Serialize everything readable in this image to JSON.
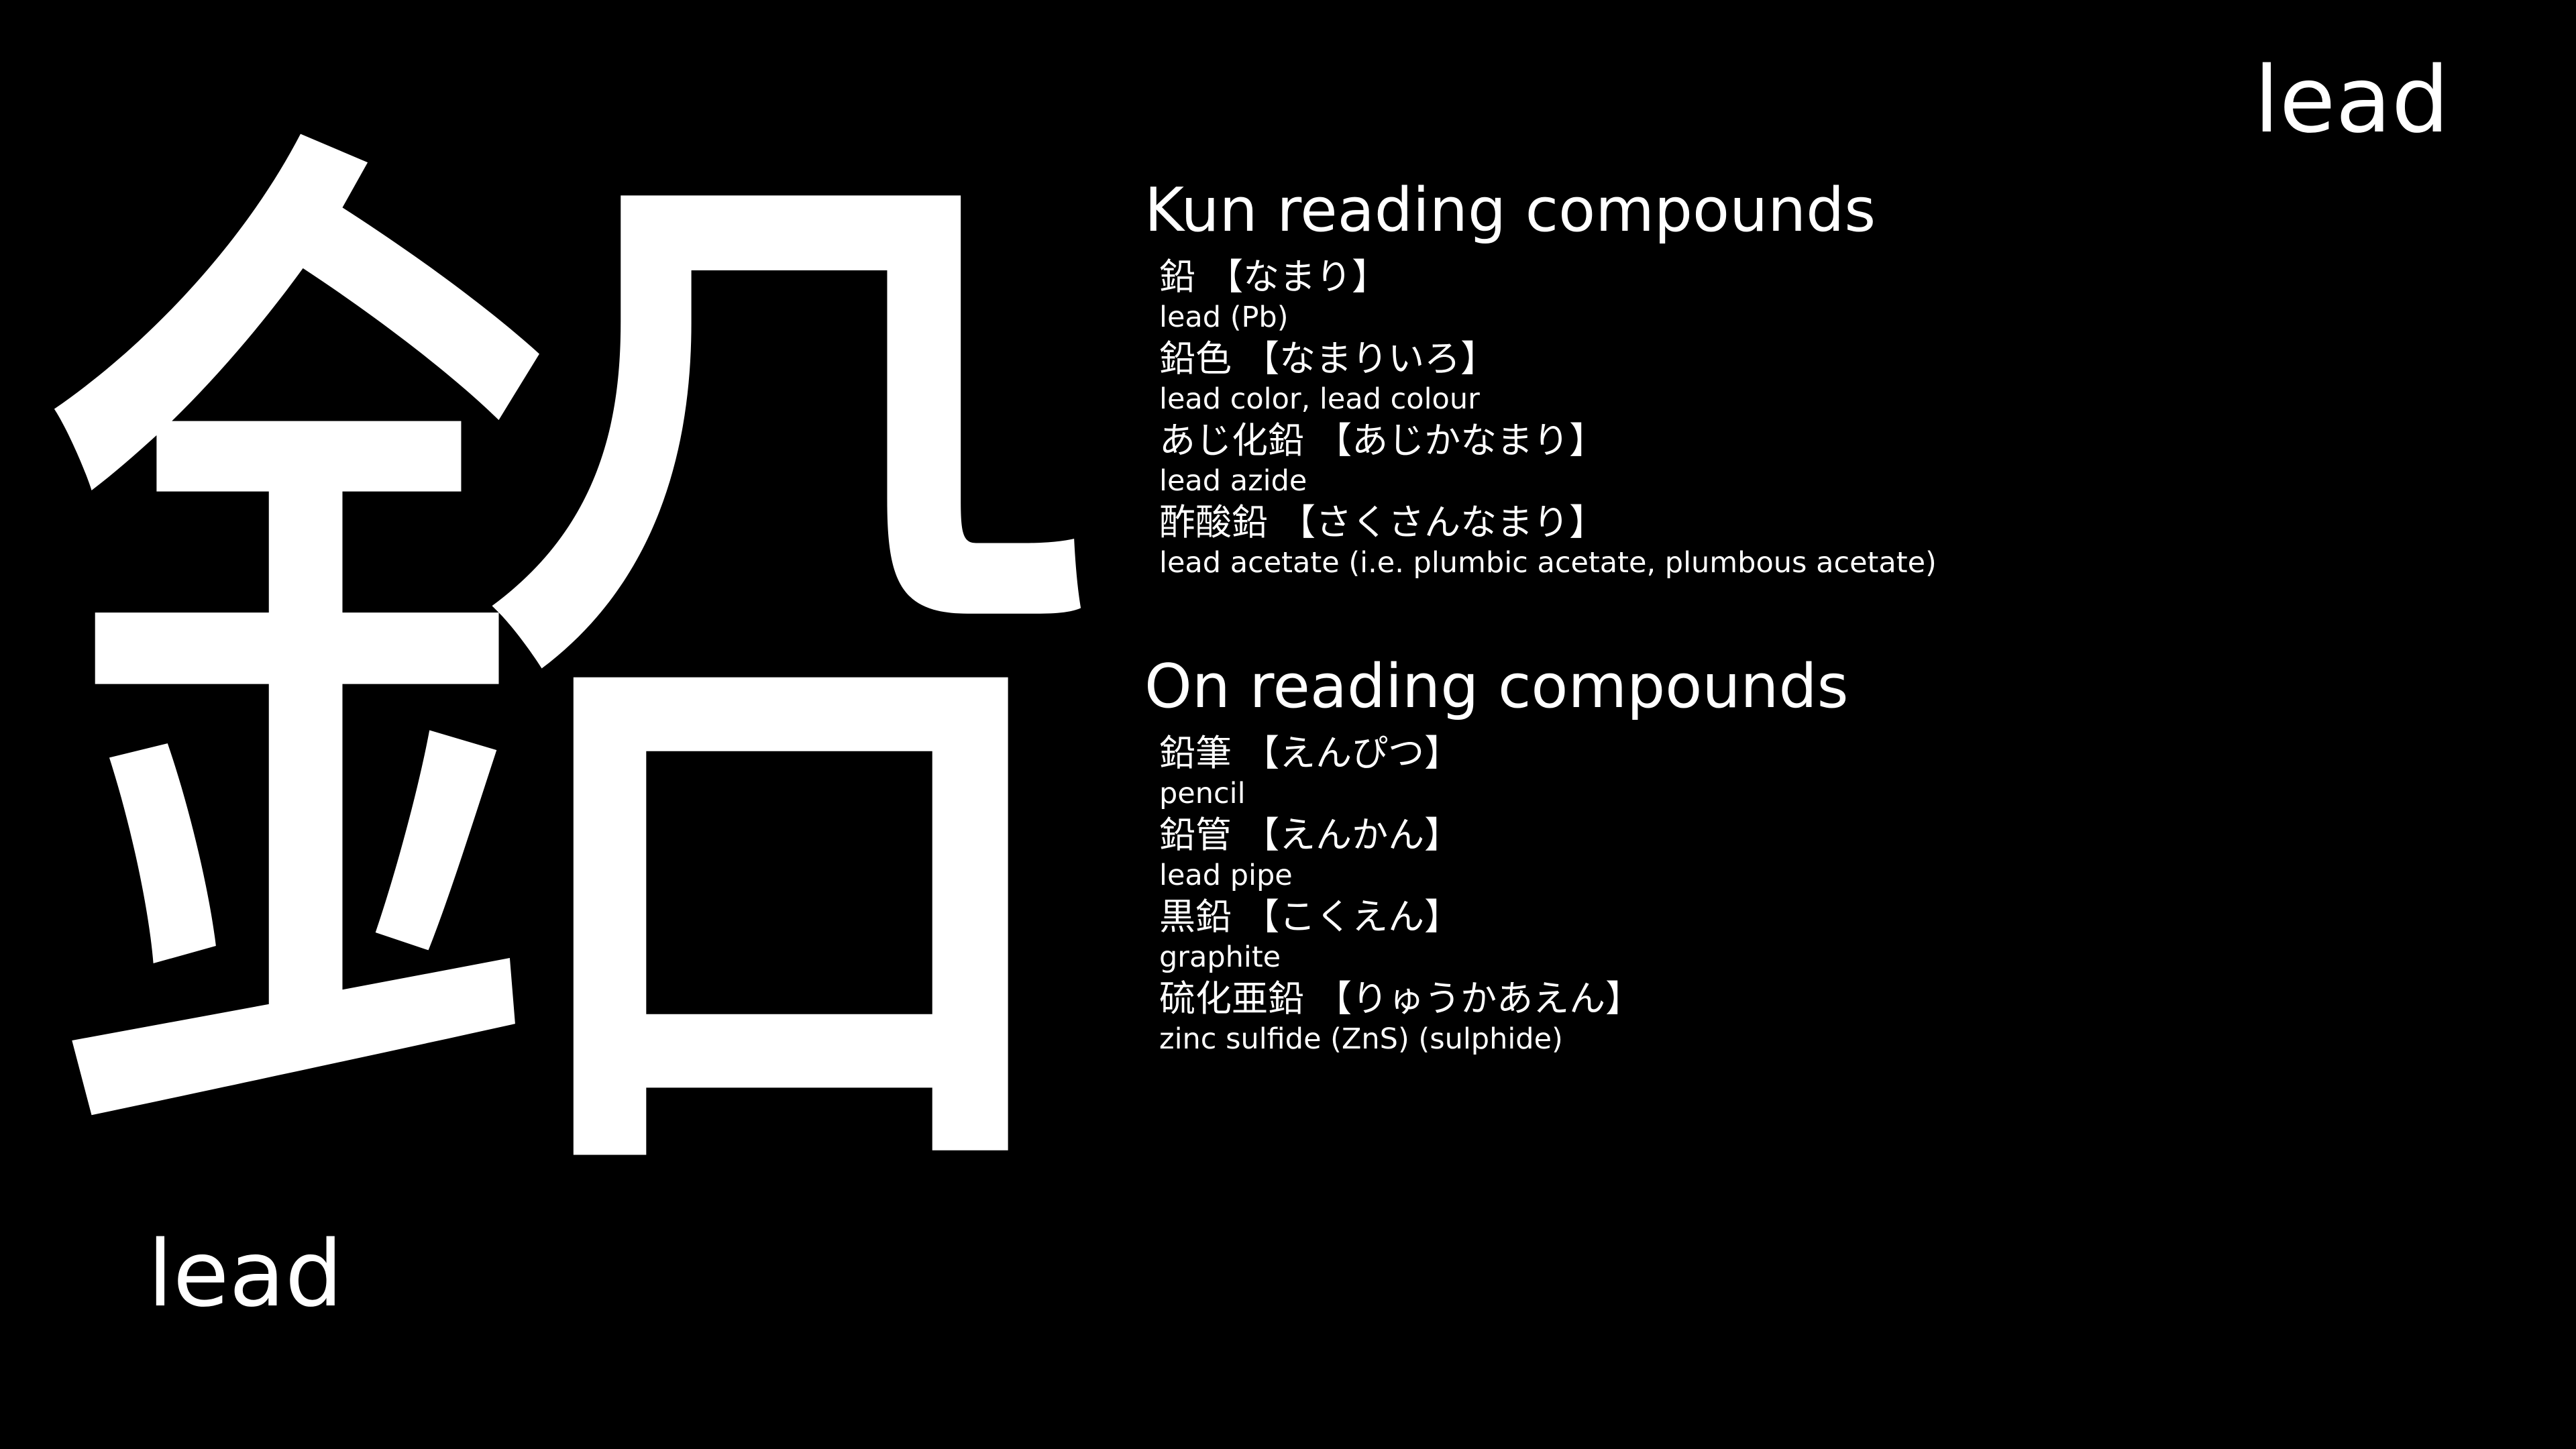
{
  "kanji": "鉛",
  "meaning": "lead",
  "kun": {
    "title": "Kun reading compounds",
    "items": [
      {
        "word": "鉛",
        "reading": "【なまり】",
        "meaning": "lead (Pb)"
      },
      {
        "word": "鉛色",
        "reading": "【なまりいろ】",
        "meaning": "lead color, lead colour"
      },
      {
        "word": "あじ化鉛",
        "reading": "【あじかなまり】",
        "meaning": "lead azide"
      },
      {
        "word": "酢酸鉛",
        "reading": "【さくさんなまり】",
        "meaning": "lead acetate (i.e. plumbic acetate, plumbous acetate)"
      }
    ]
  },
  "on": {
    "title": "On reading compounds",
    "items": [
      {
        "word": "鉛筆",
        "reading": "【えんぴつ】",
        "meaning": "pencil"
      },
      {
        "word": "鉛管",
        "reading": "【えんかん】",
        "meaning": "lead pipe"
      },
      {
        "word": "黒鉛",
        "reading": "【こくえん】",
        "meaning": "graphite"
      },
      {
        "word": "硫化亜鉛",
        "reading": "【りゅうかあえん】",
        "meaning": "zinc sulfide (ZnS) (sulphide)"
      }
    ]
  }
}
